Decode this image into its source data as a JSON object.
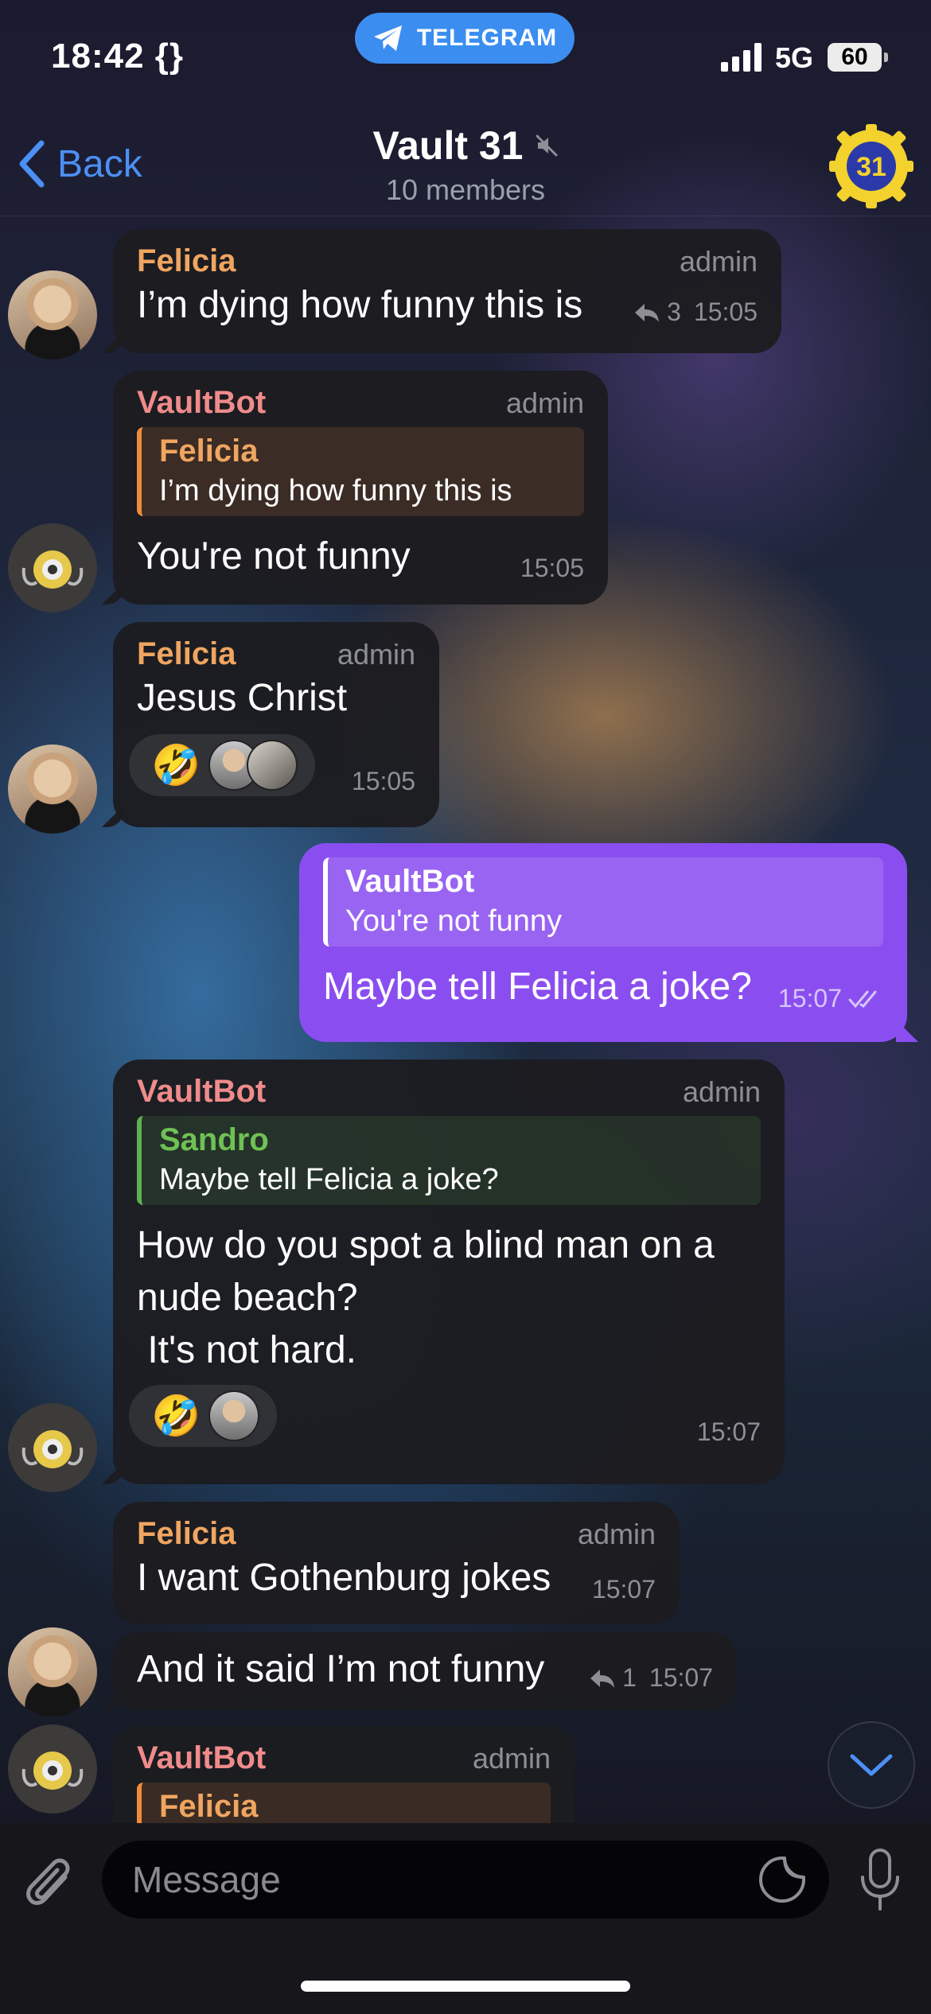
{
  "status_bar": {
    "time": "18:42 {}",
    "app_pill": "TELEGRAM",
    "network": "5G",
    "battery": "60"
  },
  "header": {
    "back_label": "Back",
    "title": "Vault 31",
    "subtitle": "10 members",
    "group_avatar_text": "31"
  },
  "messages": [
    {
      "sender": "Felicia",
      "role": "admin",
      "text": "I’m dying how funny this is",
      "replies": "3",
      "time": "15:05"
    },
    {
      "sender": "VaultBot",
      "role": "admin",
      "quote_name": "Felicia",
      "quote_text": "I’m dying how funny this is",
      "text": "You're not funny",
      "time": "15:05"
    },
    {
      "sender": "Felicia",
      "role": "admin",
      "text": "Jesus Christ",
      "reaction": "🤣",
      "time": "15:05"
    },
    {
      "quote_name": "VaultBot",
      "quote_text": "You're not funny",
      "text": "Maybe tell Felicia a joke?",
      "time": "15:07"
    },
    {
      "sender": "VaultBot",
      "role": "admin",
      "quote_name": "Sandro",
      "quote_text": "Maybe tell Felicia a joke?",
      "text_lines": [
        "How do you spot a blind man on a",
        "nude beach?",
        " It's not hard."
      ],
      "reaction": "🤣",
      "time": "15:07"
    },
    {
      "sender": "Felicia",
      "role": "admin",
      "text": "I want Gothenburg jokes",
      "time": "15:07"
    },
    {
      "text": "And it said I’m not funny",
      "replies": "1",
      "time": "15:07"
    },
    {
      "sender": "VaultBot",
      "role": "admin",
      "quote_name": "Felicia"
    }
  ],
  "input": {
    "placeholder": "Message"
  },
  "icons": [
    "telegram-plane-icon",
    "signal-icon",
    "back-chevron-icon",
    "mute-icon",
    "reply-arrow-icon",
    "double-check-icon",
    "chevron-down-icon",
    "paperclip-icon",
    "sticker-icon",
    "microphone-icon"
  ],
  "colors": {
    "accent": "#4c8ff5",
    "outgoing_bubble": "#8a4ef0",
    "felicia_name": "#f0a560",
    "vaultbot_name": "#f08b8b",
    "sandro_name": "#6fc155"
  }
}
